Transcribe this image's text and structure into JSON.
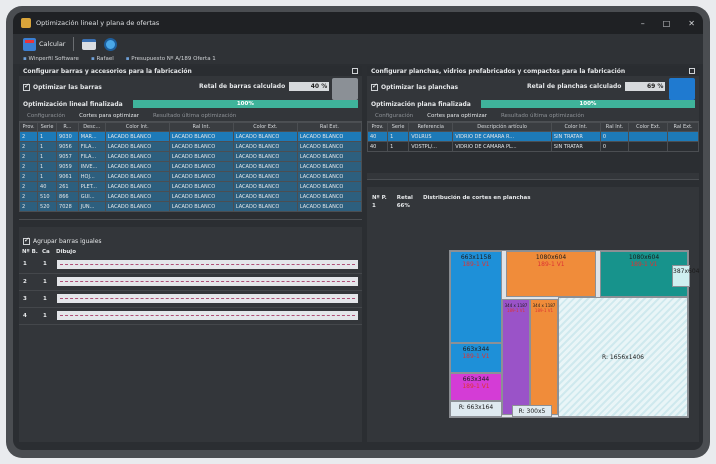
{
  "window": {
    "title": "Optimización lineal y plana de ofertas",
    "controls": [
      "–",
      "□",
      "✕"
    ]
  },
  "toolbar": {
    "calcular_label": "Calcular"
  },
  "breadcrumb": {
    "items": [
      "Winperfil Software",
      "Rafael",
      "Presupuesto Nº A/189 Oferta 1"
    ]
  },
  "left": {
    "header": "Configurar barras y accesorios para la fabricación",
    "optimize_label": "Optimizar las barras",
    "retal_label": "Retal de barras calculado",
    "retal_value": "40 %",
    "progress_label": "Optimización lineal finalizada",
    "progress_value": "100%",
    "progress_fraction": 1.0,
    "tabs": [
      "Configuración",
      "Cortes para optimizar",
      "Resultado última optimización"
    ],
    "columns": [
      "Prov.",
      "Serie",
      "R...",
      "Desc...",
      "Color Int.",
      "Ral Int.",
      "Color Ext.",
      "Ral Ext."
    ],
    "rows": [
      [
        "2",
        "1",
        "9030",
        "MAR...",
        "LACADO BLANCO",
        "LACADO BLANCO",
        "LACADO BLANCO",
        "LACADO BLANCO"
      ],
      [
        "2",
        "1",
        "9056",
        "FILA...",
        "LACADO BLANCO",
        "LACADO BLANCO",
        "LACADO BLANCO",
        "LACADO BLANCO"
      ],
      [
        "2",
        "1",
        "9057",
        "FILA...",
        "LACADO BLANCO",
        "LACADO BLANCO",
        "LACADO BLANCO",
        "LACADO BLANCO"
      ],
      [
        "2",
        "1",
        "9059",
        "INVE...",
        "LACADO BLANCO",
        "LACADO BLANCO",
        "LACADO BLANCO",
        "LACADO BLANCO"
      ],
      [
        "2",
        "1",
        "9061",
        "HOJ...",
        "LACADO BLANCO",
        "LACADO BLANCO",
        "LACADO BLANCO",
        "LACADO BLANCO"
      ],
      [
        "2",
        "40",
        "261",
        "PLET...",
        "LACADO BLANCO",
        "LACADO BLANCO",
        "LACADO BLANCO",
        "LACADO BLANCO"
      ],
      [
        "2",
        "510",
        "866",
        "GUI...",
        "LACADO BLANCO",
        "LACADO BLANCO",
        "LACADO BLANCO",
        "LACADO BLANCO"
      ],
      [
        "2",
        "520",
        "7028",
        "JUN...",
        "LACADO BLANCO",
        "LACADO BLANCO",
        "LACADO BLANCO",
        "LACADO BLANCO"
      ]
    ],
    "group_label": "Agrupar barras iguales",
    "bars_columns": [
      "Nº B.",
      "Ca",
      "Dibujo"
    ],
    "bars": [
      {
        "n": "1",
        "ca": "1"
      },
      {
        "n": "2",
        "ca": "1"
      },
      {
        "n": "3",
        "ca": "1"
      },
      {
        "n": "4",
        "ca": "1"
      }
    ]
  },
  "right": {
    "header": "Configurar planchas, vidrios prefabricados y compactos para la fabricación",
    "optimize_label": "Optimizar las planchas",
    "retal_label": "Retal de planchas calculado",
    "retal_value": "69 %",
    "progress_label": "Optimización plana finalizada",
    "progress_value": "100%",
    "progress_fraction": 1.0,
    "tabs": [
      "Configuración",
      "Cortes para optimizar",
      "Resultado última optimización"
    ],
    "columns": [
      "Prov.",
      "Serie",
      "Referencia",
      "Descripción artículo",
      "Color Int.",
      "Ral Int.",
      "Color Ext.",
      "Ral Ext."
    ],
    "rows": [
      [
        "40",
        "1",
        "VOLRUS",
        "VIDRIO DE CAMARA R...",
        "SIN TRATAR",
        "0",
        "",
        ""
      ],
      [
        "40",
        "1",
        "VOSTPL/...",
        "VIDRIO DE CAMARA PL...",
        "SIN TRATAR",
        "0",
        "",
        ""
      ]
    ],
    "dist_columns": [
      "Nº P.",
      "Retal",
      "Distribución de cortes en planchas"
    ],
    "dist_row": {
      "n": "1",
      "retal": "66%"
    },
    "pieces": [
      {
        "size": "663x1158",
        "id": "189-1 V1",
        "color": "#1e90d8"
      },
      {
        "size": "1080x604",
        "id": "189-1 V1",
        "color": "#f08c3a"
      },
      {
        "size": "1080x604",
        "id": "189-1 V1",
        "color": "#17938c"
      },
      {
        "size": "387x604",
        "id": "",
        "color": "#cfeff0"
      },
      {
        "size": "663x344",
        "id": "189-1 V1",
        "color": "#1e90d8"
      },
      {
        "size": "663x344",
        "id": "189-1 V1",
        "color": "#d43cd6"
      },
      {
        "size": "R: 663x164",
        "id": "",
        "color": "#dfeaf0"
      },
      {
        "size": "344 x 1187",
        "id": "189-1 V1",
        "color": "#9a53c8"
      },
      {
        "size": "344 x 1187",
        "id": "189-1 V1",
        "color": "#f08c3a"
      },
      {
        "size": "R: 1656x1406",
        "id": "",
        "color": "#d6eef2"
      },
      {
        "size": "R: 300x5",
        "id": "",
        "color": "#dfeaf0"
      }
    ]
  }
}
